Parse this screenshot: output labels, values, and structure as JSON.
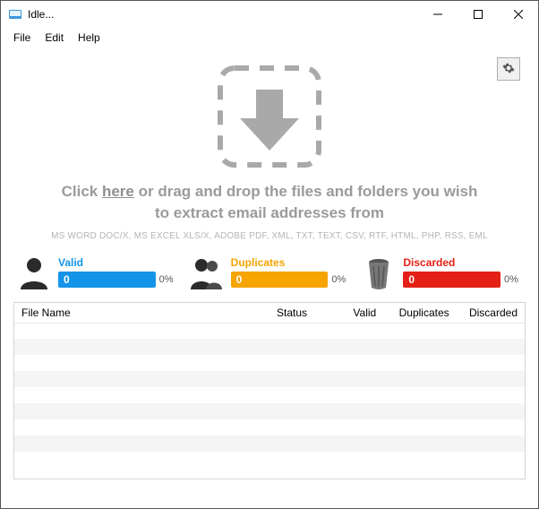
{
  "window": {
    "title": "Idle...",
    "menu": {
      "file": "File",
      "edit": "Edit",
      "help": "Help"
    }
  },
  "drop": {
    "prefix": "Click ",
    "link": "here",
    "line1_suffix": " or drag and drop the files and folders you wish",
    "line2": "to extract email addresses from",
    "formats": "MS WORD DOC/X, MS EXCEL XLS/X, ADOBE PDF, XML, TXT, TEXT, CSV, RTF, HTML, PHP, RSS, EML"
  },
  "stats": {
    "valid": {
      "label": "Valid",
      "value": "0",
      "percent": "0%"
    },
    "duplicates": {
      "label": "Duplicates",
      "value": "0",
      "percent": "0%"
    },
    "discarded": {
      "label": "Discarded",
      "value": "0",
      "percent": "0%"
    }
  },
  "table": {
    "cols": {
      "filename": "File Name",
      "status": "Status",
      "valid": "Valid",
      "duplicates": "Duplicates",
      "discarded": "Discarded"
    }
  },
  "colors": {
    "valid": "#1494e8",
    "duplicates": "#f5a402",
    "discarded": "#e52016"
  }
}
